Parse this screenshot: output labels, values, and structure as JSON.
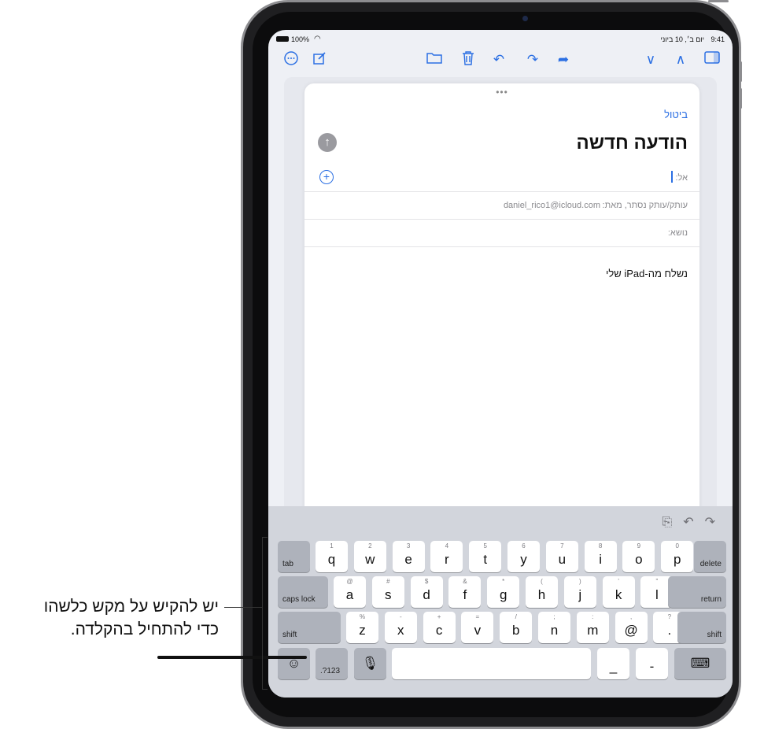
{
  "status_bar": {
    "time": "9:41",
    "date": "יום ב׳, 10 ביוני",
    "battery": "100%"
  },
  "toolbar_icons": {
    "left": [
      "more-icon",
      "compose-icon"
    ],
    "center": [
      "folder-icon",
      "trash-icon",
      "reply-icon",
      "reply-all-icon",
      "forward-icon"
    ],
    "right": [
      "chevron-down-icon",
      "chevron-up-icon",
      "sidebar-icon"
    ]
  },
  "compose": {
    "cancel_label": "ביטול",
    "title": "הודעה חדשה",
    "to_label": "אל:",
    "cc_label": "עותק/עותק נסתר, מאת:",
    "from_value": "daniel_rico1@icloud.com",
    "subject_label": "נושא:",
    "body": "נשלח מה-iPad שלי"
  },
  "keyboard": {
    "row1": [
      {
        "main": "q",
        "alt": "1"
      },
      {
        "main": "w",
        "alt": "2"
      },
      {
        "main": "e",
        "alt": "3"
      },
      {
        "main": "r",
        "alt": "4"
      },
      {
        "main": "t",
        "alt": "5"
      },
      {
        "main": "y",
        "alt": "6"
      },
      {
        "main": "u",
        "alt": "7"
      },
      {
        "main": "i",
        "alt": "8"
      },
      {
        "main": "o",
        "alt": "9"
      },
      {
        "main": "p",
        "alt": "0"
      }
    ],
    "row2": [
      {
        "main": "a",
        "alt": "@"
      },
      {
        "main": "s",
        "alt": "#"
      },
      {
        "main": "d",
        "alt": "$"
      },
      {
        "main": "f",
        "alt": "&"
      },
      {
        "main": "g",
        "alt": "*"
      },
      {
        "main": "h",
        "alt": "("
      },
      {
        "main": "j",
        "alt": ")"
      },
      {
        "main": "k",
        "alt": "'"
      },
      {
        "main": "l",
        "alt": "\""
      }
    ],
    "row3": [
      {
        "main": "z",
        "alt": "%"
      },
      {
        "main": "x",
        "alt": "-"
      },
      {
        "main": "c",
        "alt": "+"
      },
      {
        "main": "v",
        "alt": "="
      },
      {
        "main": "b",
        "alt": "/"
      },
      {
        "main": "n",
        "alt": ";"
      },
      {
        "main": "m",
        "alt": ":"
      },
      {
        "main": "@",
        "alt": ","
      },
      {
        "main": ".",
        "alt": "?"
      }
    ],
    "tab": "tab",
    "delete": "delete",
    "caps_lock": "caps lock",
    "return": "return",
    "shift": "shift",
    "numbers": ".?123",
    "underscore": "_",
    "dash": "-"
  },
  "callout": {
    "line1": "יש להקיש על מקש כלשהו",
    "line2": "כדי להתחיל בהקלדה."
  }
}
